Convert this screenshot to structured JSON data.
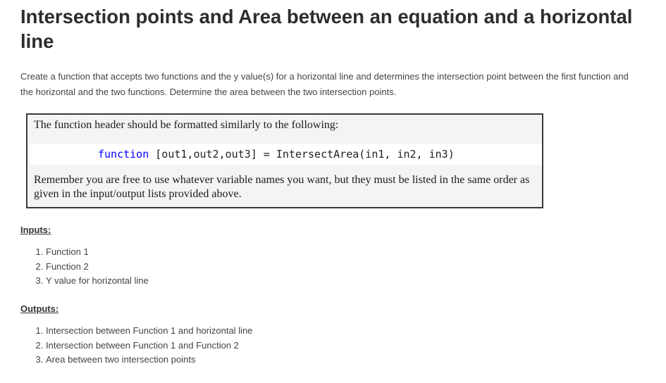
{
  "title": "Intersection points and Area between an equation and a horizontal line",
  "description": "Create  a function that accepts two functions and the y value(s) for a horizontal line and determines the intersection point between the first function and the horizontal and the two functions.  Determine the area between the two intersection points.",
  "note": {
    "intro": "The function header should be formatted similarly to the following:",
    "code_keyword": "function",
    "code_rest": " [out1,out2,out3] = IntersectArea(in1, in2, in3)",
    "remember": "Remember you are free to use whatever variable names you want, but they must be listed in the same order as given in the input/output lists provided above."
  },
  "inputs": {
    "heading": "Inputs:",
    "items": [
      "Function 1",
      "Function 2",
      "Y value for horizontal line"
    ]
  },
  "outputs": {
    "heading": "Outputs:",
    "items": [
      "Intersection between Function 1 and horizontal line",
      "Intersection between Function 1 and Function 2",
      "Area between two intersection points"
    ]
  },
  "colors": {
    "code_keyword": "#0000ff",
    "note_background": "#f4f4f4",
    "note_border": "#3a3a3a"
  }
}
